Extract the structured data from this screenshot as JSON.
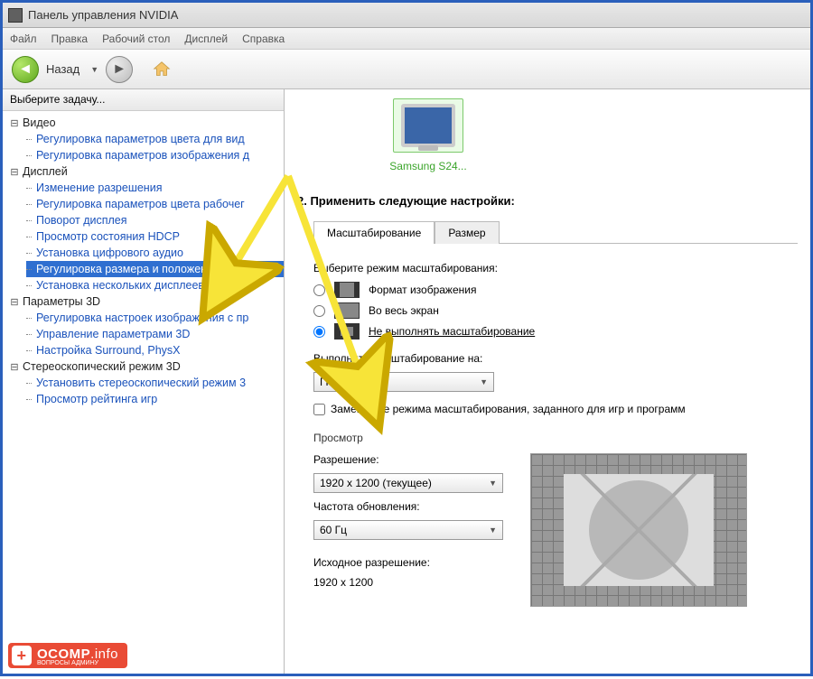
{
  "window": {
    "title": "Панель управления NVIDIA"
  },
  "menu": {
    "file": "Файл",
    "edit": "Правка",
    "desktop": "Рабочий стол",
    "display": "Дисплей",
    "help": "Справка"
  },
  "toolbar": {
    "back": "Назад"
  },
  "sidebar": {
    "header": "Выберите задачу...",
    "groups": [
      {
        "label": "Видео",
        "items": [
          "Регулировка параметров цвета для вид",
          "Регулировка параметров изображения д"
        ]
      },
      {
        "label": "Дисплей",
        "items": [
          "Изменение разрешения",
          "Регулировка параметров цвета рабочег",
          "Поворот дисплея",
          "Просмотр состояния HDCP",
          "Установка цифрового аудио",
          "Регулировка размера и положения рабоч",
          "Установка нескольких дисплеев"
        ],
        "selected_index": 5
      },
      {
        "label": "Параметры 3D",
        "items": [
          "Регулировка настроек изображения с пр",
          "Управление параметрами 3D",
          "Настройка Surround, PhysX"
        ]
      },
      {
        "label": "Стереоскопический режим 3D",
        "items": [
          "Установить стереоскопический режим 3",
          "Просмотр рейтинга игр"
        ]
      }
    ]
  },
  "main": {
    "monitor_label": "Samsung S24...",
    "section_title": "2. Применить следующие настройки:",
    "tabs": {
      "scaling": "Масштабирование",
      "size": "Размер"
    },
    "scaling_mode_label": "Выберите режим масштабирования:",
    "modes": {
      "aspect": "Формат изображения",
      "full": "Во весь экран",
      "none": "Не выполнять масштабирование"
    },
    "selected_mode": "none",
    "perform_on_label": "Выполнить масштабирование на:",
    "perform_on_value": "ГП",
    "override_checkbox": "Замещение режима масштабирования, заданного для игр и программ",
    "preview_label": "Просмотр",
    "resolution_label": "Разрешение:",
    "resolution_value": "1920 x 1200 (текущее)",
    "refresh_label": "Частота обновления:",
    "refresh_value": "60 Гц",
    "native_res_label": "Исходное разрешение:",
    "native_res_value": "1920 x 1200"
  },
  "watermark": {
    "brand": "OCOMP",
    "tld": ".info",
    "sub": "ВОПРОСЫ АДМИНУ"
  }
}
